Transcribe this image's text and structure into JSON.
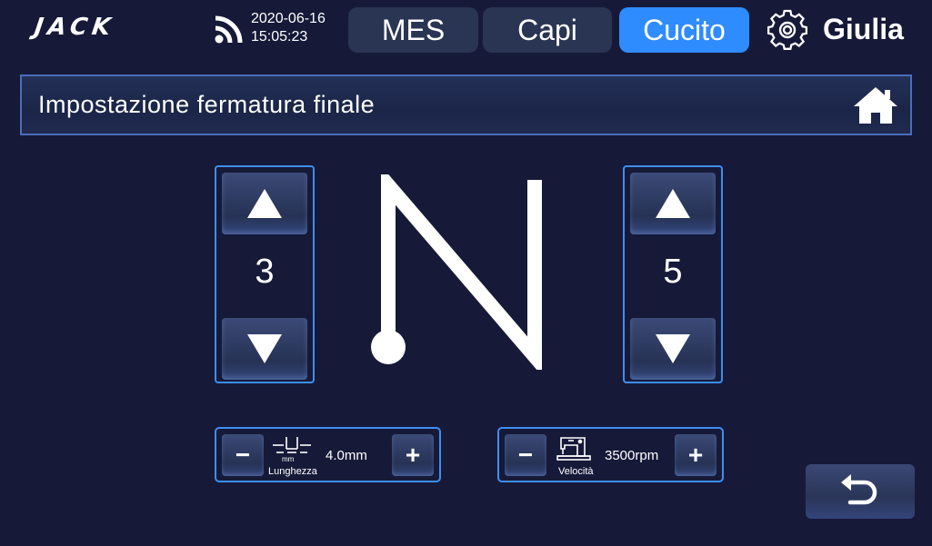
{
  "header": {
    "logo_text": "JACK",
    "date": "2020-06-16",
    "time": "15:05:23",
    "tabs": [
      {
        "label": "MES",
        "active": false
      },
      {
        "label": "Capi",
        "active": false
      },
      {
        "label": "Cucito",
        "active": true
      }
    ],
    "user_name": "Giulia",
    "icons": {
      "signal": "wifi-icon",
      "settings": "gear-icon"
    }
  },
  "page": {
    "title": "Impostazione fermatura finale",
    "home_icon": "home-icon"
  },
  "steppers": {
    "left_value": "3",
    "right_value": "5"
  },
  "length_control": {
    "label": "Lunghezza",
    "unit_caption": "mm",
    "value": "4.0mm",
    "minus": "−",
    "plus": "+"
  },
  "speed_control": {
    "label": "Velocità",
    "value": "3500rpm",
    "minus": "−",
    "plus": "+"
  },
  "colors": {
    "background": "#161a38",
    "active_tab": "#2f8cff",
    "inactive_tab": "#2a3453",
    "border_accent": "#3f8ef2"
  }
}
